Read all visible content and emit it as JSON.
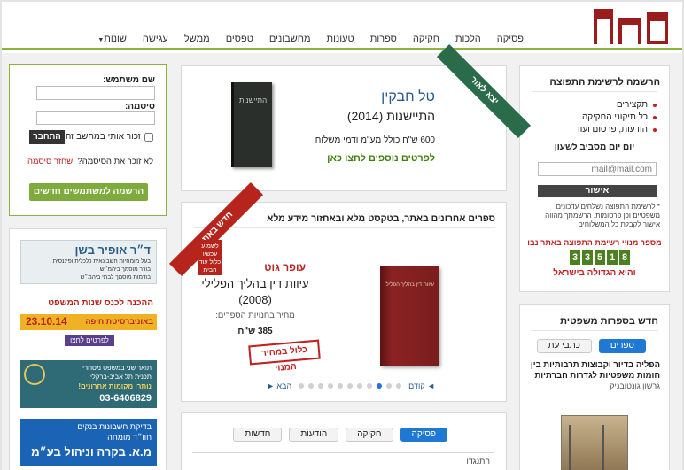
{
  "brand": {
    "logo_text": "נבו"
  },
  "nav": {
    "items": [
      "פסיקה",
      "הלכות",
      "חקיקה",
      "ספרות",
      "טעונות",
      "מחשבונים",
      "טפסים",
      "ממשל",
      "עגישה",
      "שונות"
    ]
  },
  "promo": {
    "ribbon": "יצא לאור",
    "author": "טל חבקין",
    "title": "התיישנות (2014)",
    "price": "600 ש\"ח כולל מע\"מ ודמי משלוח",
    "link": "לפרטים נוספים לחצו כאן",
    "cover_text": "התיישנות"
  },
  "recent": {
    "header": "ספרים אחרונים באתר, בטקסט מלא ובאחזור מידע מלא",
    "ribbon_main": "חדש באתר",
    "ribbon_sub": "לשמוע עכשיו כלול עוד הבית",
    "author": "עופר גוט",
    "title": "עיוות דין בהליך הפלילי",
    "year": "(2008)",
    "price_label": "מחיר בחנויות הספרים:",
    "price": "385 ש\"ח",
    "stamp": "כלול במחיר המנוי",
    "prev": "◄ קודם",
    "next": "הבא ►",
    "cover_text": "עיוות דין בהליך הפלילי"
  },
  "bottom_tabs": {
    "tabs": [
      "פסיקה",
      "חקיקה",
      "הודעות",
      "חדשות"
    ],
    "row_text": "התנגדו"
  },
  "login": {
    "username_label": "שם משתמש:",
    "password_label": "סיסמה:",
    "login_button": "התחבר",
    "remember_label": "זכור אותי במחשב זה",
    "forgot_question": "לא זוכר את הסיסמה?",
    "forgot_link": "שחזר סיסמה",
    "register_button": "הרשמה למשתמשים חדשים"
  },
  "mailing": {
    "title": "הרשמה לרשימת התפוצה",
    "items": [
      "תקצירים",
      "כל תיקוני החקיקה",
      "הודעות, פרסום ועוד"
    ],
    "subtitle": "יום יום מסביב לשעון",
    "email_placeholder": "mail@mail.com",
    "confirm_button": "אישור",
    "note": "* לרשימת התפוצה נשלחים עדכונים משפטיים וכן פרסומות. הרשמתך מהווה אישור לקבלת כל המשלוחים",
    "count_label": "מספר מנויי רשימת התפוצה באתר נבו",
    "digits": [
      "3",
      "3",
      "5",
      "1",
      "8"
    ],
    "count_footer": "והיא הגדולה בישראל"
  },
  "legal": {
    "title": "חדש בספרות משפטית",
    "tab_active": "ספרים",
    "tab_other": "כתבי עת",
    "book_title": "הפליה בדיור וקבוצות תרבותיות בין חומות משפטיות לגדרות חברתיות",
    "book_author": "גרשון גונטובניק"
  },
  "ads": {
    "ad1_line1": "ד״ר אופיר בשן",
    "ad1_line2": "בעל מומחיות חשבונאית כלכלית ופיננסית",
    "ad1_line3": "בורר מוסמך ביהמ״ש",
    "ad1_line4": "בודמות מוסמך לבתי ביהמ״ש",
    "ad2_line1": "ההכנה לכנס שנות המשפט",
    "ad2_date": "23.10.14",
    "ad2_place": "באוניברסיטת חיפה",
    "ad2_cta": "לפרטים לחצו",
    "ad3_line1": "תואר שני במשפט מסחרי",
    "ad3_line2": "תכנית תל אביב-ברקלי",
    "ad3_line3": "נותרו מקומות אחרונים!",
    "ad3_phone": "03-6406829",
    "ad4_line1": "בדיקת חשבונות בנקים",
    "ad4_line2": "חוו״ד מומחה",
    "ad4_line3": "מ.א. בקרה וניהול בע״מ"
  }
}
